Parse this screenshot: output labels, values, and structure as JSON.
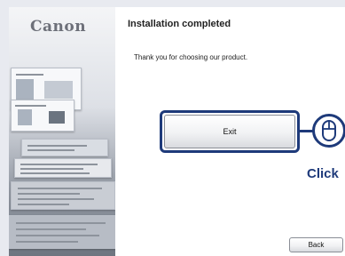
{
  "sidebar": {
    "logo": "Canon"
  },
  "main": {
    "title": "Installation completed",
    "message": "Thank you for choosing our product.",
    "exit_label": "Exit",
    "callout": "Click",
    "back_label": "Back"
  },
  "colors": {
    "callout_blue": "#1e3a7a",
    "sidebar_gray": "#6e7580",
    "logo_gray": "#6d7079"
  },
  "icons": [
    "mouse-icon"
  ]
}
